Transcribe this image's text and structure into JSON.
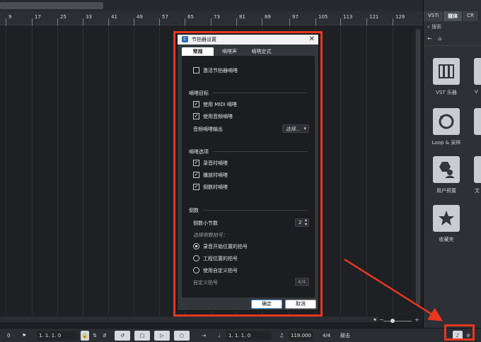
{
  "ruler": {
    "labels": [
      "9",
      "17",
      "25",
      "33",
      "41",
      "49",
      "57",
      "65",
      "73",
      "81",
      "89",
      "97",
      "105",
      "113",
      "121",
      "129"
    ]
  },
  "right_panel": {
    "tabs": [
      "VSTi",
      "媒体",
      "CR"
    ],
    "search_placeholder": "搜索",
    "tiles": [
      {
        "label": "VST 乐器",
        "icon": "piano-keys-icon"
      },
      {
        "label": "Loop & 采样",
        "icon": "loop-icon"
      },
      {
        "label": "用户预置",
        "icon": "user-preset-icon"
      },
      {
        "label": "收藏夹",
        "icon": "star-icon"
      }
    ],
    "partial_labels": [
      "V",
      "文"
    ]
  },
  "dialog": {
    "title": "节拍器设置",
    "tabs": [
      "常规",
      "嘀嗒声",
      "嘀嗒定式"
    ],
    "activate_label": "激活节拍器嘀嗒",
    "section_target": "嘀嗒目标",
    "midi_click_label": "使用 MIDI 嘀嗒",
    "audio_click_label": "使用音频嘀嗒",
    "audio_output_label": "音频嘀嗒输出",
    "audio_output_value": "选择...",
    "section_options": "嘀嗒选项",
    "record_label": "录音时嘀嗒",
    "play_label": "播放时嘀嗒",
    "countin_click_label": "倒数时嘀嗒",
    "section_countin": "倒数",
    "countin_bars_label": "倒数小节数",
    "countin_bars_value": "2",
    "choose_sig_label": "选择倒数拍号：",
    "radio_record_pos": "录音开始位置的拍号",
    "radio_project_pos": "工程位置的拍号",
    "radio_custom": "使用自定义拍号",
    "custom_sig_label": "自定义拍号",
    "custom_sig_value": "4/4",
    "ok_label": "确定",
    "cancel_label": "取消"
  },
  "bottom_bar": {
    "left_value": "0",
    "position1": "1. 1. 1.  0",
    "position2": "1. 1. 1.  0",
    "position3": "1. 1. 1.  0",
    "tempo": "119.000",
    "signature": "4/4",
    "click_label": "敲击"
  },
  "colors": {
    "highlight": "#e8361f",
    "accent": "#2b6cb0"
  }
}
